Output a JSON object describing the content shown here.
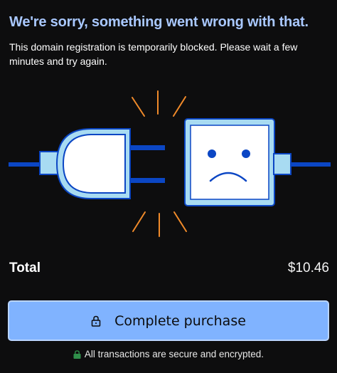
{
  "error": {
    "title": "We're sorry, something went wrong with that.",
    "message": "This domain registration is temporarily blocked. Please wait a few minutes and try again."
  },
  "illustration": {
    "plug_icon": "unplugged-cable-icon",
    "socket_icon": "sad-face-socket-icon",
    "colors": {
      "outline": "#0b46c4",
      "fill_light": "#a8dbf2",
      "face_bg": "#ffffff",
      "spark": "#f08a2a"
    }
  },
  "order": {
    "total_label": "Total",
    "total_value": "$10.46"
  },
  "actions": {
    "purchase_label": "Complete purchase",
    "purchase_icon": "lock-icon"
  },
  "footer": {
    "secure_text": "All transactions are secure and encrypted.",
    "secure_icon": "lock-icon",
    "secure_icon_color": "#2f8f4a"
  },
  "theme": {
    "background": "#0d0d0e",
    "title_color": "#a9c8ff",
    "button_color": "#80b3ff"
  }
}
